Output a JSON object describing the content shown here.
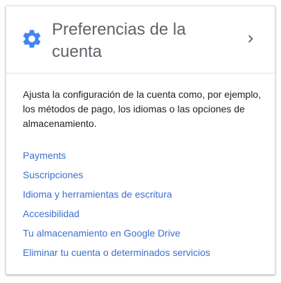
{
  "card": {
    "title": "Preferencias de la cuenta",
    "icon": "gear-icon",
    "expand_icon": "chevron-right-icon",
    "description": "Ajusta la configuración de la cuenta como, por ejemplo, los métodos de pago, los idiomas o las opciones de almacenamiento.",
    "links": [
      {
        "label": "Payments"
      },
      {
        "label": "Suscripciones"
      },
      {
        "label": "Idioma y herramientas de escritura"
      },
      {
        "label": "Accesibilidad"
      },
      {
        "label": "Tu almacenamiento en Google Drive"
      },
      {
        "label": "Eliminar tu cuenta o determinados servicios"
      }
    ]
  },
  "colors": {
    "accent": "#4285f4",
    "link": "#3b6fcf",
    "title_text": "#5f6368",
    "body_text": "#202124",
    "divider": "#e0e0e0"
  }
}
